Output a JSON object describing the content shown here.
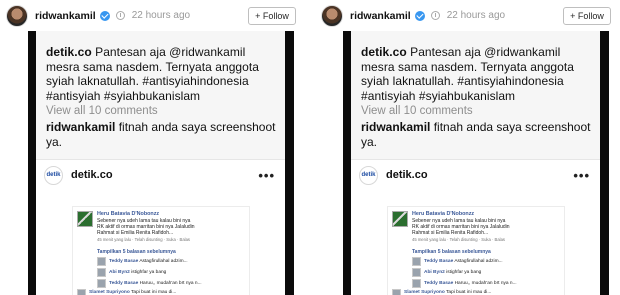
{
  "panels": [
    {
      "post": {
        "username": "ridwankamil",
        "time": "22 hours ago",
        "follow_label": "+ Follow"
      },
      "caption_user": "detik.co",
      "caption_text": "Pantesan aja @ridwankamil mesra sama nasdem. Ternyata anggota syiah laknatullah. #antisyiahindonesia #antisyiah #syiahbukanislam",
      "view_comments": "View all 10 comments",
      "reply_user": "ridwankamil",
      "reply_text": "fitnah anda saya screenshoot ya.",
      "embed": {
        "avatar_text": "detik",
        "name": "detik.co",
        "dots": "•••"
      },
      "fb": {
        "name": "Heru Batavia D'Nobonzz",
        "lines": [
          "Sebener nya udeh lama tau kalau bini nya",
          "RK aktif di ormas marritan bini nya Jalaludin",
          "Rahmat si Emilia Renita Rafidoh..."
        ],
        "meta": "45 menit yang lalu · Telah disunting · Suka · Balas",
        "more": "Tampilkan 5 balasan sebelumnya",
        "replies": [
          {
            "name": "Teddy Basae",
            "text": "Astagfirullahal adzim..."
          },
          {
            "name": "Abi Byn2",
            "text": "istighfar ya bang"
          },
          {
            "name": "Teddy Basae",
            "text": "Haruu,, mudah'an brt nya n..."
          },
          {
            "name": "Slamet Supriyono",
            "text": "Tapi buat ini mau di..."
          }
        ]
      }
    },
    {
      "post": {
        "username": "ridwankamil",
        "time": "22 hours ago",
        "follow_label": "+ Follow"
      },
      "caption_user": "detik.co",
      "caption_text": "Pantesan aja @ridwankamil mesra sama nasdem. Ternyata anggota syiah laknatullah. #antisyiahindonesia #antisyiah #syiahbukanislam",
      "view_comments": "View all 10 comments",
      "reply_user": "ridwankamil",
      "reply_text": "fitnah anda saya screenshoot ya.",
      "embed": {
        "avatar_text": "detik",
        "name": "detik.co",
        "dots": "•••"
      },
      "fb": {
        "name": "Heru Batavia D'Nobonzz",
        "lines": [
          "Sebener nya udeh lama tau kalau bini nya",
          "RK aktif di ormas marritan bini nya Jalaludin",
          "Rahmat si Emilia Renita Rafidoh..."
        ],
        "meta": "45 menit yang lalu · Telah disunting · Suka · Balas",
        "more": "Tampilkan 5 balasan sebelumnya",
        "replies": [
          {
            "name": "Teddy Basae",
            "text": "Astagfirullahal adzim..."
          },
          {
            "name": "Abi Byn2",
            "text": "istighfar ya bang"
          },
          {
            "name": "Teddy Basae",
            "text": "Haruu,, mudah'an brt nya n..."
          },
          {
            "name": "Slamet Supriyono",
            "text": "Tapi buat ini mau di..."
          }
        ]
      }
    }
  ]
}
